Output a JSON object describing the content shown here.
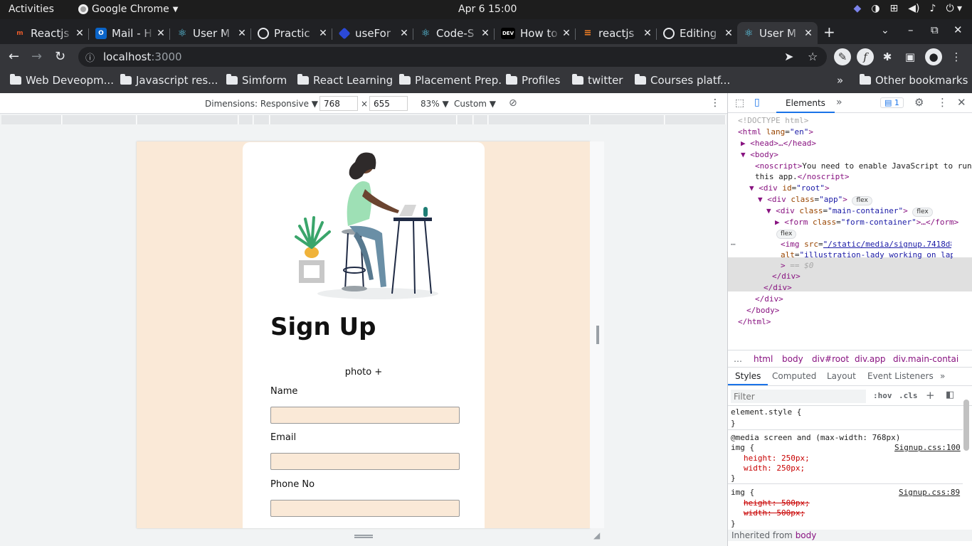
{
  "system": {
    "activities": "Activities",
    "app_name": "Google Chrome",
    "clock": "Apr 6  15:00"
  },
  "tabs": [
    {
      "title": "Reactjs",
      "color": "#e65a2a",
      "glyph": "m"
    },
    {
      "title": "Mail - H",
      "color": "#0a64c8",
      "glyph": "O"
    },
    {
      "title": "User M",
      "color": "#35363a",
      "glyph": "⚛"
    },
    {
      "title": "Practic",
      "color": "#35363a",
      "glyph": "◯"
    },
    {
      "title": "useFor",
      "color": "#2b49d8",
      "glyph": "◆"
    },
    {
      "title": "Code-S",
      "color": "#35363a",
      "glyph": "⚛"
    },
    {
      "title": "How to",
      "color": "#000000",
      "glyph": "DEV"
    },
    {
      "title": "reactjs",
      "color": "#f48024",
      "glyph": "≡"
    },
    {
      "title": "Editing",
      "color": "#35363a",
      "glyph": "◯"
    },
    {
      "title": "User M",
      "color": "#35363a",
      "glyph": "⚛",
      "active": true
    }
  ],
  "omnibox": {
    "host": "localhost",
    "port": ":3000"
  },
  "bookmarks": [
    "Web Deveopm...",
    "Javascript res...",
    "Simform",
    "React Learning",
    "Placement Prep.",
    "Profiles",
    "twitter",
    "Courses platf...",
    "Other bookmarks"
  ],
  "device_toolbar": {
    "dimensions": "Dimensions: Responsive ▼",
    "width": "768",
    "times": "×",
    "height": "655",
    "zoom": "83% ▼",
    "throttle": "Custom ▼"
  },
  "signup": {
    "title": "Sign Up",
    "photo_label": "photo +",
    "fields": [
      {
        "label": "Name"
      },
      {
        "label": "Email"
      },
      {
        "label": "Phone No"
      }
    ]
  },
  "devtools": {
    "elements_tab": "Elements",
    "issues_count": "1",
    "dom": {
      "doctype": "<!DOCTYPE html>",
      "html_open": "html",
      "html_lang": "\"en\"",
      "head": "<head>…</head>",
      "body": "<body>",
      "noscript_text": "You need to enable JavaScript to run",
      "noscript_text2": "this app.",
      "div_root": "\"root\"",
      "div_app": "\"app\"",
      "div_main": "\"main-container\"",
      "form_class": "\"form-container\"",
      "img_src": "\"/static/media/signup.7418d89….png\"",
      "img_alt": "\"illustration-lady working on laptop\"",
      "dollar": "== $0",
      "flex": "flex"
    },
    "breadcrumbs": [
      "html",
      "body",
      "div#root",
      "div.app",
      "div.main-contai"
    ],
    "style_tabs": [
      "Styles",
      "Computed",
      "Layout",
      "Event Listeners"
    ],
    "filter_placeholder": "Filter",
    "filter_hov": ":hov",
    "filter_cls": ".cls",
    "rules": {
      "element_style": "element.style {",
      "close": "}",
      "media": "@media screen and (max-width: 768px)",
      "img_sel": "img {",
      "src1": "Signup.css:100",
      "src2": "Signup.css:89",
      "h1": "height: 250px;",
      "w1": "width: 250px;",
      "h2": "height: 500px;",
      "w2": "width: 500px;",
      "inherited": "Inherited from",
      "inherited_el": "body"
    }
  }
}
